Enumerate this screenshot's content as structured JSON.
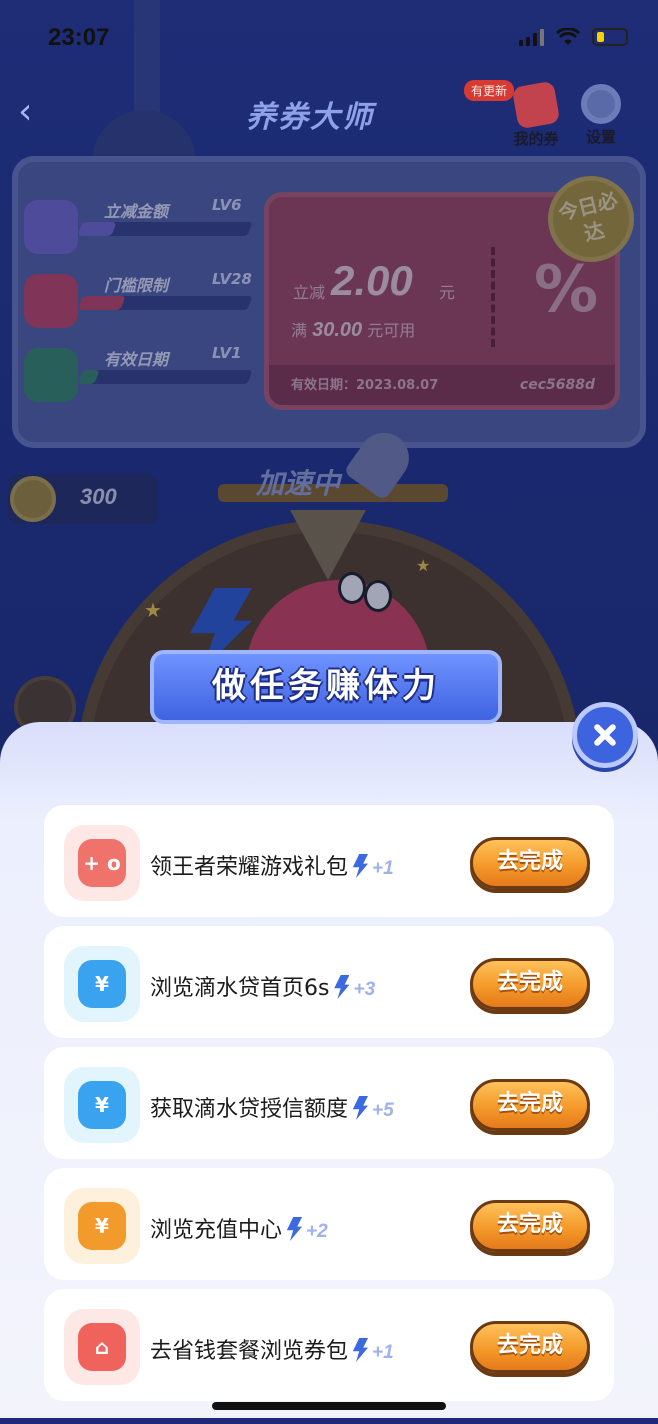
{
  "status_bar": {
    "time": "23:07"
  },
  "header": {
    "title": "养券大师",
    "new_badge": "有更新",
    "my_coupon_label": "我的券",
    "settings_label": "设置"
  },
  "attributes": [
    {
      "name": "立减金额",
      "level": "LV6",
      "progress": 0.2,
      "color": "#7a6fd6"
    },
    {
      "name": "门槛限制",
      "level": "LV28",
      "progress": 0.25,
      "color": "#c84968"
    },
    {
      "name": "有效日期",
      "level": "LV1",
      "progress": 0.1,
      "color": "#3d8f6e"
    }
  ],
  "coupon": {
    "prefix": "立减",
    "amount": "2.00",
    "unit": "元",
    "condition_prefix": "满",
    "condition_amount": "30.00",
    "condition_suffix": "元可用",
    "validity": "有效日期：2023.08.07",
    "code": "cec5688d",
    "today_badge": "今日必达"
  },
  "coins": "300",
  "speed_label": "加速中",
  "modal": {
    "title": "做任务赚体力",
    "tasks": [
      {
        "label": "领王者荣耀游戏礼包",
        "reward": "+1",
        "button": "去完成",
        "icon": "gamepad-icon",
        "bg": "#fde8e5",
        "fg": "#f0736b",
        "glyph": "+ o"
      },
      {
        "label": "浏览滴水贷首页6s",
        "reward": "+3",
        "button": "去完成",
        "icon": "water-drop-icon",
        "bg": "#e2f4fc",
        "fg": "#3aa3f0",
        "glyph": "¥"
      },
      {
        "label": "获取滴水贷授信额度",
        "reward": "+5",
        "button": "去完成",
        "icon": "water-drop-icon",
        "bg": "#e2f4fc",
        "fg": "#3aa3f0",
        "glyph": "¥"
      },
      {
        "label": "浏览充值中心",
        "reward": "+2",
        "button": "去完成",
        "icon": "ticket-icon",
        "bg": "#fdf1de",
        "fg": "#f39a2c",
        "glyph": "¥"
      },
      {
        "label": "去省钱套餐浏览券包",
        "reward": "+1",
        "button": "去完成",
        "icon": "car-icon",
        "bg": "#fde8e5",
        "fg": "#f0625c",
        "glyph": "⌂"
      }
    ]
  }
}
